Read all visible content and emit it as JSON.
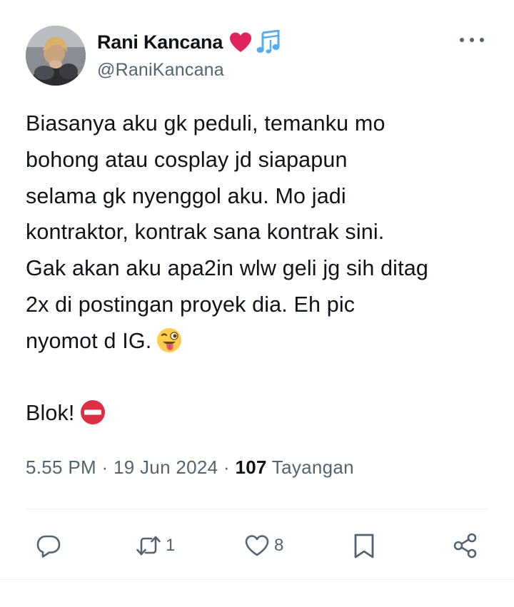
{
  "author": {
    "display_name": "Rani Kancana",
    "handle": "@RaniKancana",
    "name_emojis": [
      "red-heart-icon",
      "musical-notes-icon"
    ]
  },
  "tweet": {
    "lines": [
      "Biasanya aku gk peduli, temanku mo",
      "bohong atau cosplay jd siapapun",
      "selama gk nyenggol aku. Mo jadi",
      "kontraktor, kontrak sana kontrak sini.",
      "Gak akan aku apa2in wlw geli jg sih ditag",
      "2x di postingan proyek dia. Eh pic",
      "nyomot d IG.",
      "",
      "Blok!"
    ],
    "inline_emojis": [
      "winking-tongue-face-icon",
      "no-entry-icon"
    ]
  },
  "meta": {
    "time": "5.55 PM",
    "separator": "·",
    "date": "19 Jun 2024",
    "views_count": "107",
    "views_label": "Tayangan"
  },
  "actions": {
    "reply_count": "",
    "retweet_count": "1",
    "like_count": "8"
  },
  "colors": {
    "text": "#0f1419",
    "secondary": "#536471",
    "divider": "#eff3f4",
    "heart": "#e0245e",
    "notes": "#55acee"
  }
}
